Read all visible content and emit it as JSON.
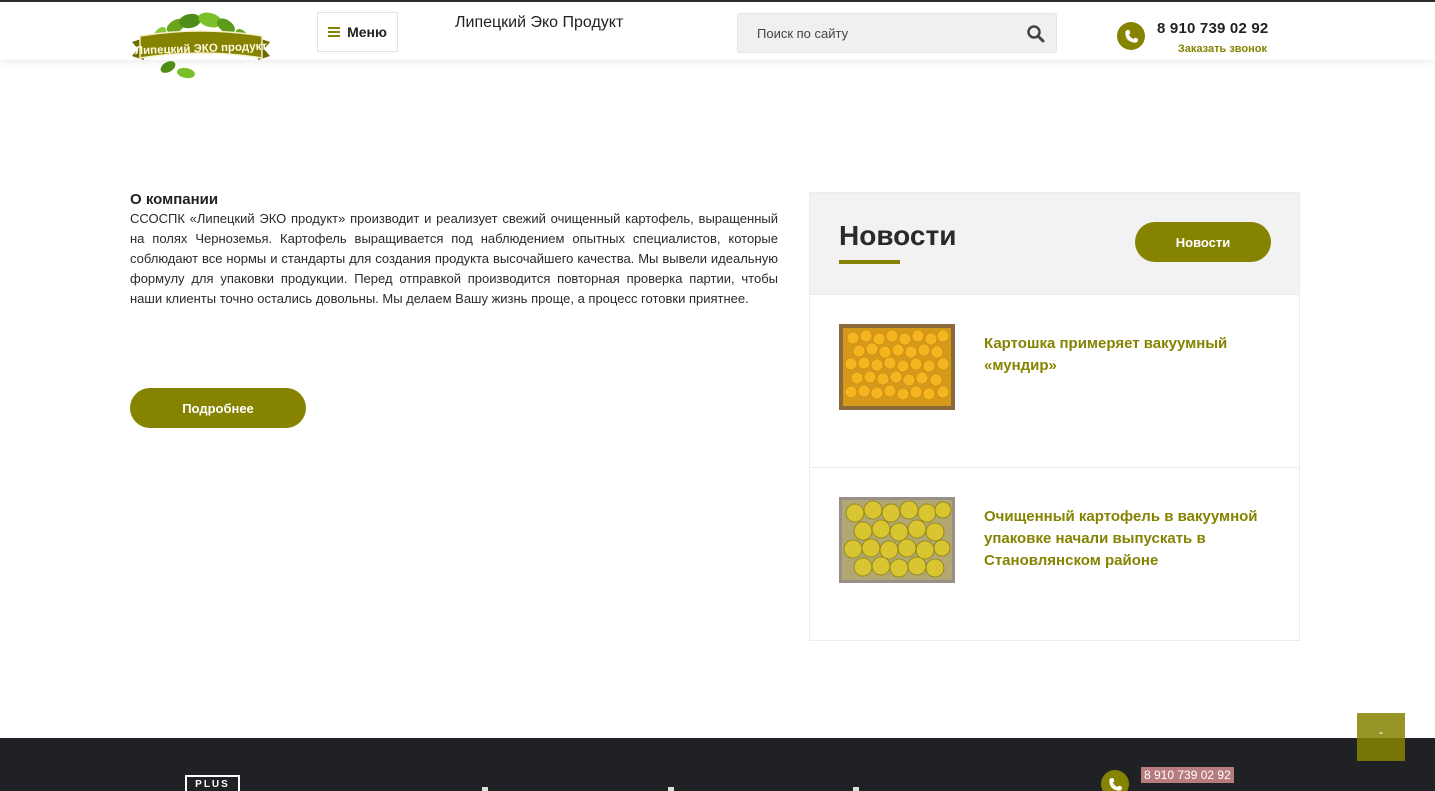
{
  "colors": {
    "accent": "#858300",
    "text": "#222222",
    "panel": "#f2f2f2",
    "footer": "#1f2124",
    "phone_highlight": "#b77c7f"
  },
  "header": {
    "logo_text": "Липецкий ЭКО продукт",
    "menu_label": "Меню",
    "site_title": "Липецкий Эко Продукт",
    "search_placeholder": "Поиск по сайту",
    "phone": "8 910 739 02 92",
    "callback_label": "Заказать звонок",
    "icons": [
      "menu-icon",
      "search-icon",
      "phone-icon"
    ]
  },
  "about": {
    "title": "О компании",
    "text": "ССОСПК «Липецкий ЭКО продукт» производит и реализует свежий очищенный картофель, выращенный на полях Черноземья. Картофель выращивается под наблюдением опытных специалистов, которые соблюдают все нормы и стандарты для создания продукта высочайшего качества. Мы вывели идеальную формулу для упаковки продукции. Перед отправкой производится повторная проверка партии, чтобы наши клиенты точно остались довольны. Мы делаем Вашу жизнь проще, а процесс готовки приятнее.",
    "button_label": "Подробнее"
  },
  "news": {
    "title": "Новости",
    "button_label": "Новости",
    "items": [
      {
        "title": "Картошка примеряет вакуумный «мундир»"
      },
      {
        "title": "Очищенный картофель в вакуумной упаковке начали выпускать в Становлянском районе"
      }
    ]
  },
  "footer": {
    "logo_text": "PLUS",
    "phone": "8 910 739 02 92",
    "icons": [
      "phone-icon",
      "scroll-top-icon"
    ]
  }
}
